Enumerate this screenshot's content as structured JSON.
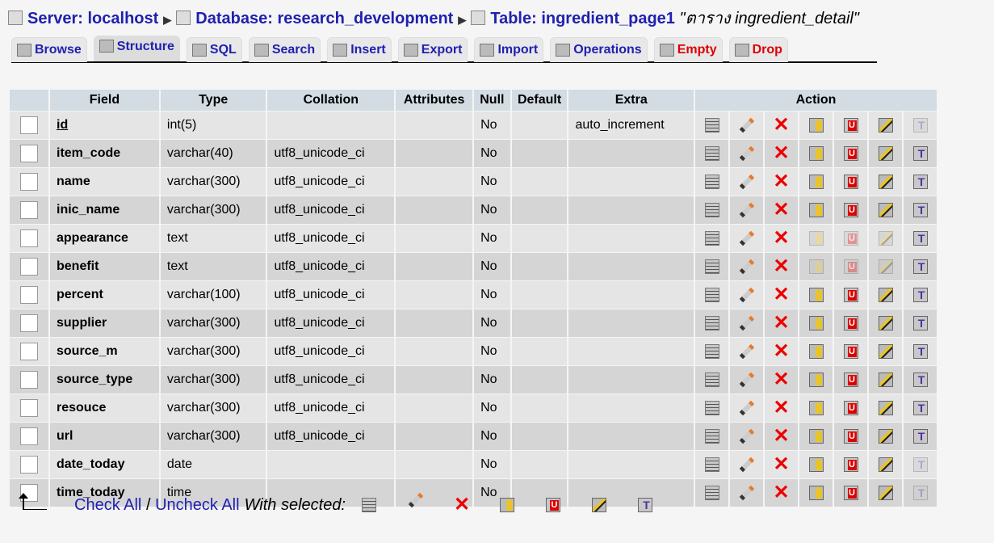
{
  "breadcrumb": {
    "server": "Server: localhost",
    "database": "Database: research_development",
    "table": "Table: ingredient_page1",
    "comment": "\"ตาราง ingredient_detail\""
  },
  "tabs": [
    "Browse",
    "Structure",
    "SQL",
    "Search",
    "Insert",
    "Export",
    "Import",
    "Operations",
    "Empty",
    "Drop"
  ],
  "headers": {
    "field": "Field",
    "type": "Type",
    "collation": "Collation",
    "attributes": "Attributes",
    "null": "Null",
    "default": "Default",
    "extra": "Extra",
    "action": "Action"
  },
  "rows": [
    {
      "field": "id",
      "type": "int(5)",
      "collation": "",
      "attributes": "",
      "null": "No",
      "default": "",
      "extra": "auto_increment",
      "pk": true,
      "disabled": [
        "fulltext"
      ]
    },
    {
      "field": "item_code",
      "type": "varchar(40)",
      "collation": "utf8_unicode_ci",
      "attributes": "",
      "null": "No",
      "default": "",
      "extra": "",
      "disabled": []
    },
    {
      "field": "name",
      "type": "varchar(300)",
      "collation": "utf8_unicode_ci",
      "attributes": "",
      "null": "No",
      "default": "",
      "extra": "",
      "disabled": []
    },
    {
      "field": "inic_name",
      "type": "varchar(300)",
      "collation": "utf8_unicode_ci",
      "attributes": "",
      "null": "No",
      "default": "",
      "extra": "",
      "disabled": []
    },
    {
      "field": "appearance",
      "type": "text",
      "collation": "utf8_unicode_ci",
      "attributes": "",
      "null": "No",
      "default": "",
      "extra": "",
      "disabled": [
        "primary",
        "unique",
        "index"
      ]
    },
    {
      "field": "benefit",
      "type": "text",
      "collation": "utf8_unicode_ci",
      "attributes": "",
      "null": "No",
      "default": "",
      "extra": "",
      "disabled": [
        "primary",
        "unique",
        "index"
      ]
    },
    {
      "field": "percent",
      "type": "varchar(100)",
      "collation": "utf8_unicode_ci",
      "attributes": "",
      "null": "No",
      "default": "",
      "extra": "",
      "disabled": []
    },
    {
      "field": "supplier",
      "type": "varchar(300)",
      "collation": "utf8_unicode_ci",
      "attributes": "",
      "null": "No",
      "default": "",
      "extra": "",
      "disabled": []
    },
    {
      "field": "source_m",
      "type": "varchar(300)",
      "collation": "utf8_unicode_ci",
      "attributes": "",
      "null": "No",
      "default": "",
      "extra": "",
      "disabled": []
    },
    {
      "field": "source_type",
      "type": "varchar(300)",
      "collation": "utf8_unicode_ci",
      "attributes": "",
      "null": "No",
      "default": "",
      "extra": "",
      "disabled": []
    },
    {
      "field": "resouce",
      "type": "varchar(300)",
      "collation": "utf8_unicode_ci",
      "attributes": "",
      "null": "No",
      "default": "",
      "extra": "",
      "disabled": []
    },
    {
      "field": "url",
      "type": "varchar(300)",
      "collation": "utf8_unicode_ci",
      "attributes": "",
      "null": "No",
      "default": "",
      "extra": "",
      "disabled": []
    },
    {
      "field": "date_today",
      "type": "date",
      "collation": "",
      "attributes": "",
      "null": "No",
      "default": "",
      "extra": "",
      "disabled": [
        "fulltext"
      ]
    },
    {
      "field": "time_today",
      "type": "time",
      "collation": "",
      "attributes": "",
      "null": "No",
      "default": "",
      "extra": "",
      "disabled": [
        "fulltext"
      ]
    }
  ],
  "actions": [
    "browse",
    "edit",
    "drop",
    "primary",
    "unique",
    "index",
    "fulltext"
  ],
  "footer": {
    "check_all": "Check All",
    "slash": "/",
    "uncheck_all": "Uncheck All",
    "with_selected": "With selected:"
  }
}
